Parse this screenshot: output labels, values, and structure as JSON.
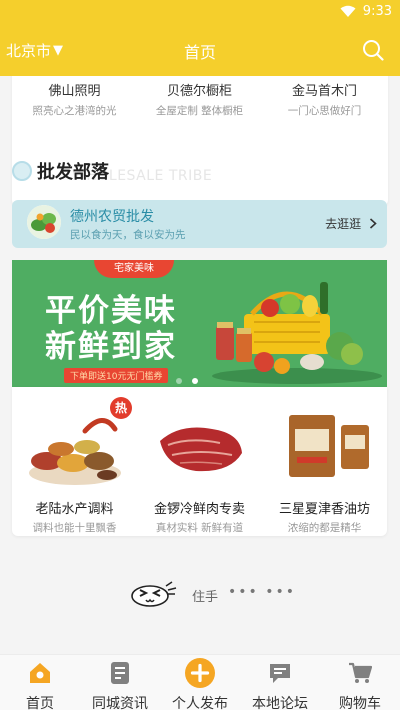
{
  "status_bar": {
    "time": "9:33"
  },
  "nav": {
    "city": "北京市",
    "city_arrow": "▼",
    "title": "首页"
  },
  "brands": [
    {
      "name": "佛山照明",
      "slogan": "照亮心之港湾的光"
    },
    {
      "name": "贝德尔橱柜",
      "slogan": "全屋定制 整体橱柜"
    },
    {
      "name": "金马首木门",
      "slogan": "一门心思做好门"
    }
  ],
  "section": {
    "title": "批发部落",
    "title_en": "WHOLESALE TRIBE"
  },
  "market": {
    "name": "德州农贸批发",
    "slogan": "民以食为天，食以安为先",
    "link": "去逛逛"
  },
  "banner": {
    "tag": "宅家美味",
    "line1": "平价美味",
    "line2": "新鲜到家",
    "note": "下单即送10元无门槛券"
  },
  "products": [
    {
      "name": "老陆水产调料",
      "sub": "调料也能十里飘香",
      "badge": "热"
    },
    {
      "name": "金锣冷鲜肉专卖",
      "sub": "真材实料 新鲜有道"
    },
    {
      "name": "三星夏津香油坊",
      "sub": "浓缩的都是精华"
    }
  ],
  "loading": {
    "face": ">ω<",
    "text": "住手",
    "dots": "••• •••"
  },
  "tabs": [
    {
      "label": "首页",
      "icon": "home-icon"
    },
    {
      "label": "同城资讯",
      "icon": "news-icon"
    },
    {
      "label": "个人发布",
      "icon": "plus-icon"
    },
    {
      "label": "本地论坛",
      "icon": "chat-icon"
    },
    {
      "label": "购物车",
      "icon": "cart-icon"
    }
  ],
  "colors": {
    "brand_yellow": "#f5cf2c",
    "accent_orange": "#f5a623",
    "banner_green": "#4fad62",
    "market_bg": "#c9e6eb",
    "hot_red": "#e23c2c"
  }
}
